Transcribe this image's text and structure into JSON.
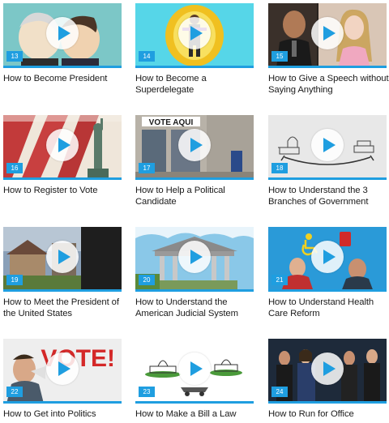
{
  "accent_color": "#1f9ee0",
  "play_icon": "play-icon",
  "videos": [
    {
      "number": "13",
      "title": "How to Become President"
    },
    {
      "number": "14",
      "title": "How to Become a Superdelegate"
    },
    {
      "number": "15",
      "title": "How to Give a Speech without Saying Anything"
    },
    {
      "number": "16",
      "title": "How to Register to Vote"
    },
    {
      "number": "17",
      "title": "How to Help a Political Candidate",
      "sign_text": "VOTE AQUI"
    },
    {
      "number": "18",
      "title": "How to Understand the 3 Branches of Government"
    },
    {
      "number": "19",
      "title": "How to Meet the President of the United States"
    },
    {
      "number": "20",
      "title": "How to Understand the American Judicial System"
    },
    {
      "number": "21",
      "title": "How to Understand Health Care Reform"
    },
    {
      "number": "22",
      "title": "How to Get into Politics",
      "sign_text": "VOTE!"
    },
    {
      "number": "23",
      "title": "How to Make a Bill a Law"
    },
    {
      "number": "24",
      "title": "How to Run for Office"
    }
  ]
}
